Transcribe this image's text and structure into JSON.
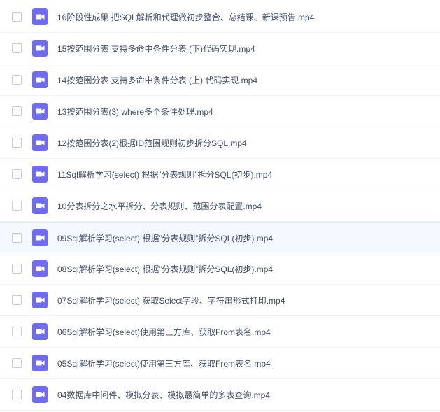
{
  "colors": {
    "icon_bg": "#6f6cf0",
    "text": "#424e67",
    "row_divider": "#f1f2f4",
    "hover_bg": "#f4f9ff"
  },
  "file_icon": "video-file-icon",
  "files": [
    {
      "name": "16阶段性成果 把SQL解析和代理做初步整合、总结课、新课预告.mp4"
    },
    {
      "name": "15按范围分表 支持多命中条件分表 (下)代码实现.mp4"
    },
    {
      "name": "14按范围分表 支持多命中条件分表 (上) 代码实现.mp4"
    },
    {
      "name": "13按范围分表(3) where多个条件处理.mp4"
    },
    {
      "name": "12按范围分表(2)根据ID范围规则初步拆分SQL.mp4"
    },
    {
      "name": "11Sql解析学习(select) 根据”分表规则”拆分SQL(初步).mp4"
    },
    {
      "name": "10分表拆分之水平拆分、分表规则、范围分表配置.mp4"
    },
    {
      "name": "09Sql解析学习(select) 根据”分表规则”拆分SQL(初步).mp4"
    },
    {
      "name": "08Sql解析学习(select) 根据”分表规则”拆分SQL(初步).mp4"
    },
    {
      "name": "07Sql解析学习(select) 获取Select字段、字符串形式打印.mp4"
    },
    {
      "name": "06Sql解析学习(select)使用第三方库、获取From表名.mp4"
    },
    {
      "name": "05Sql解析学习(select)使用第三方库、获取From表名.mp4"
    },
    {
      "name": "04数据库中间件、模拟分表、模拟最简单的多表查询.mp4"
    }
  ]
}
